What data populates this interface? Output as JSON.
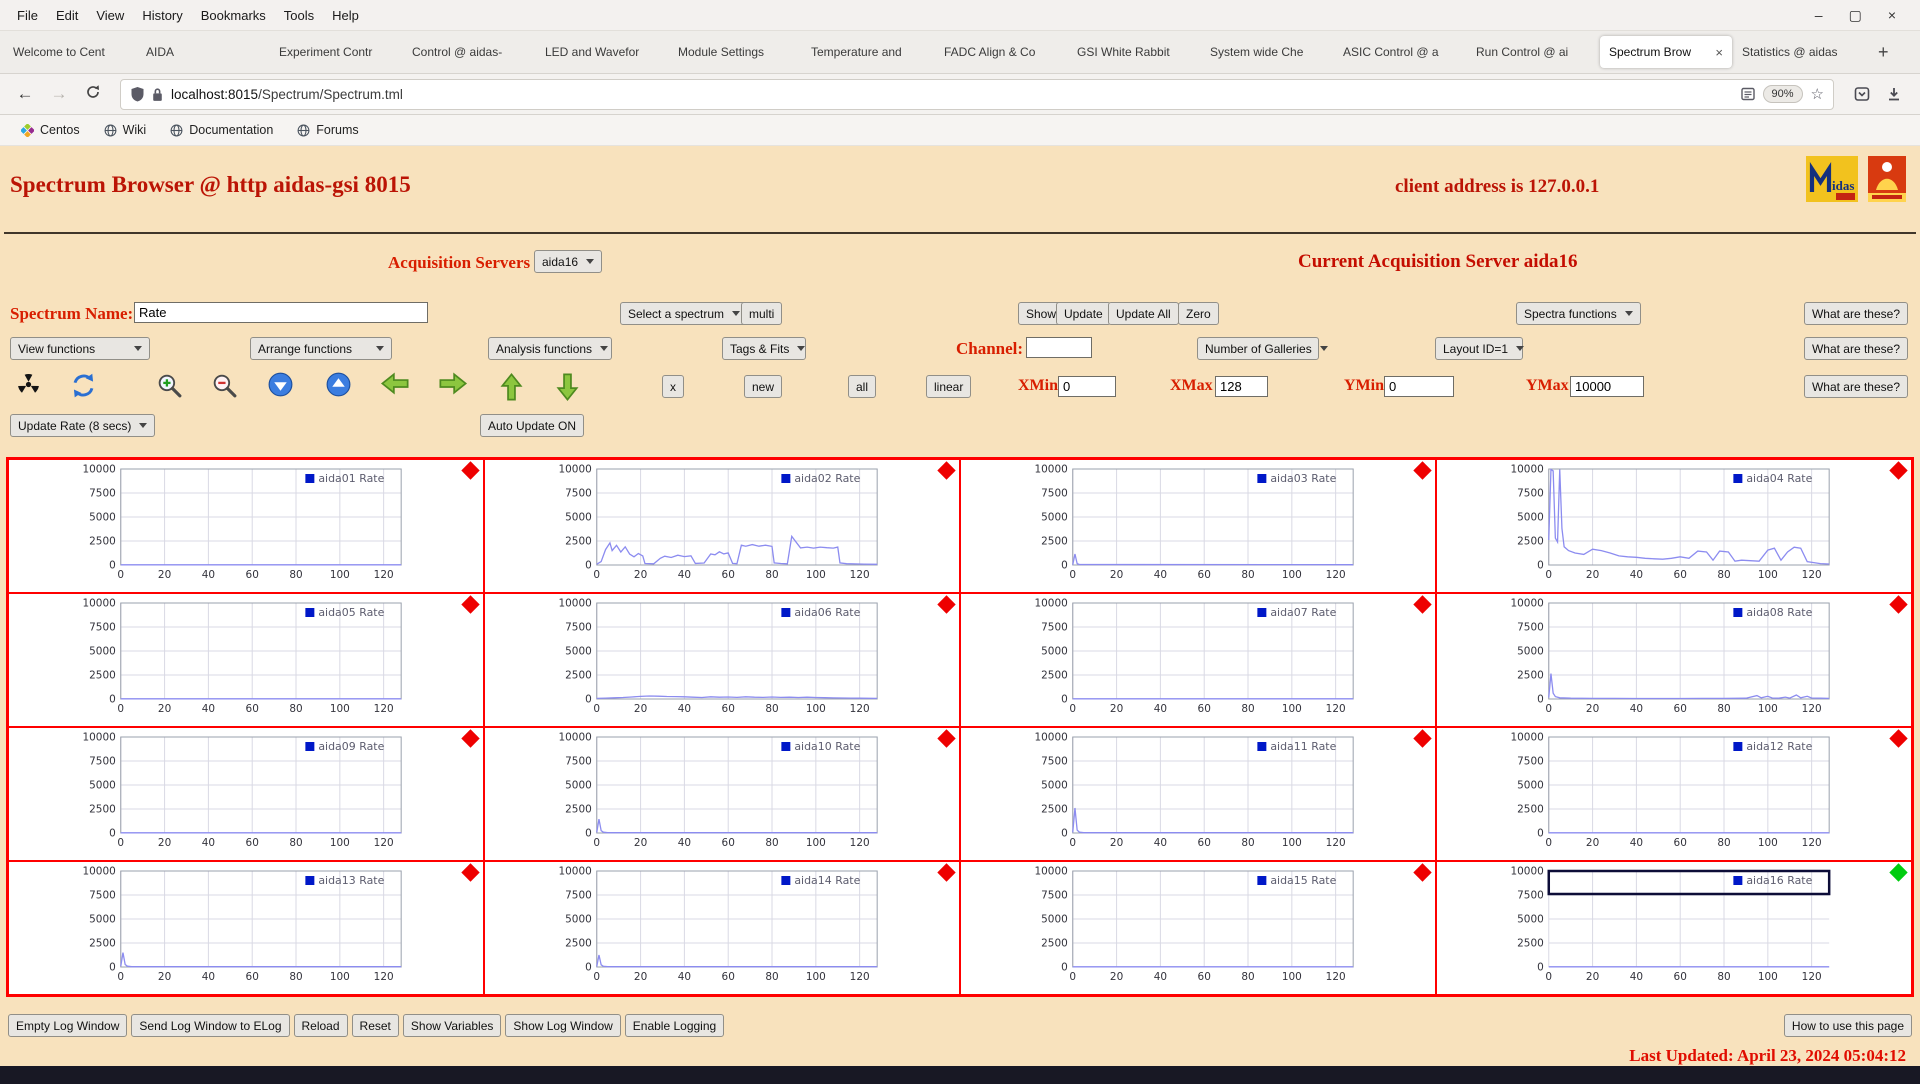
{
  "browser": {
    "menu": [
      "File",
      "Edit",
      "View",
      "History",
      "Bookmarks",
      "Tools",
      "Help"
    ],
    "window_controls": [
      "–",
      "▢",
      "×"
    ],
    "tabs": [
      {
        "label": "Welcome to Cent"
      },
      {
        "label": "AIDA"
      },
      {
        "label": "Experiment Contr"
      },
      {
        "label": "Control @ aidas-"
      },
      {
        "label": "LED and Wavefor"
      },
      {
        "label": "Module Settings"
      },
      {
        "label": "Temperature and"
      },
      {
        "label": "FADC Align & Co"
      },
      {
        "label": "GSI White Rabbit"
      },
      {
        "label": "System wide Che"
      },
      {
        "label": "ASIC Control @ a"
      },
      {
        "label": "Run Control @ ai"
      },
      {
        "label": "Spectrum Brow",
        "active": true
      },
      {
        "label": "Statistics @ aidas"
      }
    ],
    "tab_close_icon": "×",
    "new_tab_icon": "+",
    "url_host": "localhost:8015",
    "url_path": "/Spectrum/Spectrum.tml",
    "zoom_level": "90%",
    "star_icon": "☆",
    "back_icon": "←",
    "forward_icon": "→",
    "bookmarks": [
      "Centos",
      "Wiki",
      "Documentation",
      "Forums"
    ]
  },
  "page": {
    "title": "Spectrum Browser @ http aidas-gsi 8015",
    "client_address": "client address is 127.0.0.1",
    "acq_servers_label": "Acquisition Servers",
    "acq_server_value": "aida16",
    "current_server_text": "Current Acquisition Server aida16",
    "spectrum_name_label": "Spectrum Name:",
    "spectrum_name_value": "Rate",
    "select_spectrum_label": "Select a spectrum",
    "multi_button": "multi",
    "show_button": "Show",
    "update_button": "Update",
    "update_all_button": "Update All",
    "zero_button": "Zero",
    "spectra_functions_label": "Spectra functions",
    "what_are_these_button": "What are these?",
    "view_functions_label": "View functions",
    "arrange_functions_label": "Arrange functions",
    "analysis_functions_label": "Analysis functions",
    "tags_fits_label": "Tags & Fits",
    "channel_label": "Channel:",
    "channel_value": "",
    "galleries_label": "Number of Galleries",
    "layout_label": "Layout ID=1",
    "x_button": "x",
    "new_button": "new",
    "all_button": "all",
    "linear_button": "linear",
    "xmin_label": "XMin",
    "xmin_value": "0",
    "xmax_label": "XMax",
    "xmax_value": "128",
    "ymin_label": "YMin",
    "ymin_value": "0",
    "ymax_label": "YMax",
    "ymax_value": "10000",
    "update_rate_label": "Update Rate (8 secs)",
    "auto_update_button": "Auto Update ON",
    "log_buttons": [
      "Empty Log Window",
      "Send Log Window to ELog",
      "Reload",
      "Reset",
      "Show Variables",
      "Show Log Window",
      "Enable Logging"
    ],
    "how_to_button": "How to use this page",
    "last_updated": "Last Updated: April 23, 2024 05:04:12"
  },
  "chart_data": {
    "type": "line",
    "x_ticks": [
      0,
      20,
      40,
      60,
      80,
      100,
      120
    ],
    "y_ticks": [
      0,
      2500,
      5000,
      7500,
      10000
    ],
    "xlim": [
      0,
      128
    ],
    "ylim": [
      0,
      10000
    ],
    "grid": true,
    "legend_position": "top-right",
    "line_color": "#8c8cf0",
    "legend_square_color": "#0018c8",
    "marker_default": "#ee0000",
    "charts": [
      {
        "name": "aida01 Rate",
        "points": [
          [
            0,
            25
          ],
          [
            128,
            25
          ]
        ]
      },
      {
        "name": "aida02 Rate",
        "points": [
          [
            0,
            80
          ],
          [
            2,
            350
          ],
          [
            4,
            1600
          ],
          [
            6,
            2300
          ],
          [
            7,
            1500
          ],
          [
            9,
            2050
          ],
          [
            11,
            1350
          ],
          [
            13,
            1900
          ],
          [
            15,
            1150
          ],
          [
            17,
            850
          ],
          [
            19,
            1200
          ],
          [
            21,
            950
          ],
          [
            22,
            160
          ],
          [
            26,
            130
          ],
          [
            29,
            700
          ],
          [
            31,
            920
          ],
          [
            34,
            780
          ],
          [
            37,
            1020
          ],
          [
            40,
            870
          ],
          [
            43,
            960
          ],
          [
            45,
            170
          ],
          [
            49,
            210
          ],
          [
            52,
            1150
          ],
          [
            54,
            1060
          ],
          [
            56,
            1380
          ],
          [
            58,
            1160
          ],
          [
            60,
            1260
          ],
          [
            62,
            170
          ],
          [
            64,
            140
          ],
          [
            66,
            2060
          ],
          [
            68,
            1960
          ],
          [
            71,
            2120
          ],
          [
            74,
            1960
          ],
          [
            77,
            2060
          ],
          [
            80,
            1940
          ],
          [
            81,
            220
          ],
          [
            84,
            160
          ],
          [
            87,
            130
          ],
          [
            89,
            2980
          ],
          [
            91,
            2380
          ],
          [
            93,
            1780
          ],
          [
            96,
            1860
          ],
          [
            99,
            1760
          ],
          [
            102,
            1860
          ],
          [
            105,
            1800
          ],
          [
            108,
            1760
          ],
          [
            110,
            1860
          ],
          [
            111,
            220
          ],
          [
            114,
            140
          ],
          [
            118,
            110
          ],
          [
            122,
            90
          ],
          [
            128,
            70
          ]
        ]
      },
      {
        "name": "aida03 Rate",
        "points": [
          [
            0,
            30
          ],
          [
            1,
            1150
          ],
          [
            2,
            150
          ],
          [
            3,
            50
          ],
          [
            128,
            30
          ]
        ]
      },
      {
        "name": "aida04 Rate",
        "points": [
          [
            0,
            2600
          ],
          [
            1,
            9950
          ],
          [
            2,
            9800
          ],
          [
            3,
            2800
          ],
          [
            4,
            2400
          ],
          [
            5,
            9950
          ],
          [
            6,
            3800
          ],
          [
            7,
            1900
          ],
          [
            9,
            1500
          ],
          [
            12,
            1250
          ],
          [
            16,
            1100
          ],
          [
            20,
            1650
          ],
          [
            24,
            1500
          ],
          [
            28,
            1250
          ],
          [
            32,
            950
          ],
          [
            36,
            850
          ],
          [
            40,
            800
          ],
          [
            44,
            700
          ],
          [
            48,
            650
          ],
          [
            52,
            600
          ],
          [
            56,
            700
          ],
          [
            60,
            850
          ],
          [
            64,
            700
          ],
          [
            68,
            1450
          ],
          [
            72,
            1350
          ],
          [
            75,
            500
          ],
          [
            78,
            1450
          ],
          [
            82,
            1350
          ],
          [
            85,
            400
          ],
          [
            88,
            500
          ],
          [
            92,
            450
          ],
          [
            96,
            400
          ],
          [
            100,
            1550
          ],
          [
            103,
            1750
          ],
          [
            106,
            500
          ],
          [
            109,
            1350
          ],
          [
            112,
            1850
          ],
          [
            115,
            1750
          ],
          [
            118,
            350
          ],
          [
            121,
            250
          ],
          [
            124,
            150
          ],
          [
            128,
            100
          ]
        ]
      },
      {
        "name": "aida05 Rate",
        "points": [
          [
            0,
            25
          ],
          [
            128,
            25
          ]
        ]
      },
      {
        "name": "aida06 Rate",
        "points": [
          [
            0,
            60
          ],
          [
            4,
            90
          ],
          [
            8,
            130
          ],
          [
            12,
            160
          ],
          [
            16,
            210
          ],
          [
            20,
            270
          ],
          [
            24,
            310
          ],
          [
            28,
            290
          ],
          [
            32,
            265
          ],
          [
            36,
            245
          ],
          [
            40,
            225
          ],
          [
            44,
            185
          ],
          [
            48,
            155
          ],
          [
            52,
            225
          ],
          [
            56,
            185
          ],
          [
            60,
            205
          ],
          [
            64,
            165
          ],
          [
            68,
            225
          ],
          [
            72,
            185
          ],
          [
            76,
            165
          ],
          [
            80,
            205
          ],
          [
            84,
            165
          ],
          [
            88,
            185
          ],
          [
            92,
            155
          ],
          [
            96,
            185
          ],
          [
            100,
            155
          ],
          [
            104,
            135
          ],
          [
            108,
            115
          ],
          [
            112,
            105
          ],
          [
            116,
            95
          ],
          [
            120,
            85
          ],
          [
            128,
            60
          ]
        ]
      },
      {
        "name": "aida07 Rate",
        "points": [
          [
            0,
            25
          ],
          [
            128,
            25
          ]
        ]
      },
      {
        "name": "aida08 Rate",
        "points": [
          [
            0,
            150
          ],
          [
            1,
            2650
          ],
          [
            2,
            600
          ],
          [
            3,
            250
          ],
          [
            5,
            120
          ],
          [
            10,
            80
          ],
          [
            20,
            60
          ],
          [
            30,
            60
          ],
          [
            40,
            50
          ],
          [
            50,
            50
          ],
          [
            60,
            50
          ],
          [
            70,
            60
          ],
          [
            80,
            60
          ],
          [
            90,
            80
          ],
          [
            95,
            350
          ],
          [
            97,
            120
          ],
          [
            100,
            280
          ],
          [
            102,
            100
          ],
          [
            105,
            80
          ],
          [
            108,
            200
          ],
          [
            110,
            90
          ],
          [
            113,
            420
          ],
          [
            115,
            120
          ],
          [
            118,
            280
          ],
          [
            120,
            100
          ],
          [
            124,
            80
          ],
          [
            128,
            60
          ]
        ]
      },
      {
        "name": "aida09 Rate",
        "points": [
          [
            0,
            25
          ],
          [
            128,
            25
          ]
        ]
      },
      {
        "name": "aida10 Rate",
        "points": [
          [
            0,
            60
          ],
          [
            1,
            1450
          ],
          [
            2,
            250
          ],
          [
            3,
            80
          ],
          [
            5,
            35
          ],
          [
            128,
            30
          ]
        ]
      },
      {
        "name": "aida11 Rate",
        "points": [
          [
            0,
            70
          ],
          [
            1,
            2600
          ],
          [
            2,
            300
          ],
          [
            3,
            90
          ],
          [
            5,
            35
          ],
          [
            128,
            30
          ]
        ]
      },
      {
        "name": "aida12 Rate",
        "points": [
          [
            0,
            25
          ],
          [
            128,
            25
          ]
        ]
      },
      {
        "name": "aida13 Rate",
        "points": [
          [
            0,
            60
          ],
          [
            1,
            1500
          ],
          [
            2,
            260
          ],
          [
            3,
            80
          ],
          [
            5,
            35
          ],
          [
            128,
            30
          ]
        ]
      },
      {
        "name": "aida14 Rate",
        "points": [
          [
            0,
            55
          ],
          [
            1,
            1250
          ],
          [
            2,
            230
          ],
          [
            3,
            75
          ],
          [
            5,
            35
          ],
          [
            128,
            30
          ]
        ]
      },
      {
        "name": "aida15 Rate",
        "points": [
          [
            0,
            25
          ],
          [
            128,
            25
          ]
        ]
      },
      {
        "name": "aida16 Rate",
        "selected": true,
        "marker": "#00cc10",
        "points": [
          [
            0,
            25
          ],
          [
            128,
            25
          ]
        ]
      }
    ]
  }
}
